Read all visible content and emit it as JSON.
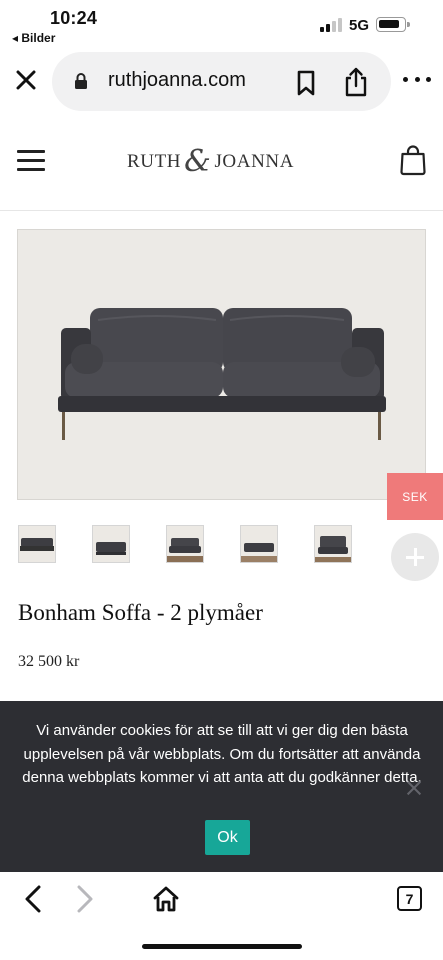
{
  "status_bar": {
    "time": "10:24",
    "back_app": "◂ Bilder",
    "network": "5G",
    "icons": [
      "signal-icon",
      "battery-icon"
    ]
  },
  "browser": {
    "url": "ruthjoanna.com",
    "icons": [
      "close-icon",
      "lock-icon",
      "bookmark-icon",
      "share-icon",
      "more-icon"
    ]
  },
  "site_header": {
    "logo": {
      "left": "RUTH",
      "amp": "&",
      "right": "JOANNA"
    },
    "icons": [
      "hamburger-menu-icon",
      "shopping-bag-icon"
    ]
  },
  "product": {
    "currency_badge": "SEK",
    "thumbnail_count": 5,
    "title": "Bonham Soffa - 2 plymåer",
    "price": "32 500 kr",
    "sofa_color": "#3d3d42",
    "image_background": "#eceae6"
  },
  "cookie_banner": {
    "text": "Vi använder cookies för att se till att vi ger dig den bästa upplevelsen på vår webbplats. Om du fortsätter att använda denna webbplats kommer vi att anta att du godkänner detta.",
    "ok_label": "Ok",
    "background": "#2d2e33",
    "ok_color": "#17a798"
  },
  "bottom_toolbar": {
    "tab_count": "7",
    "icons": [
      "back-arrow-icon",
      "forward-arrow-icon",
      "home-icon",
      "tabs-icon"
    ]
  },
  "colors": {
    "accent_badge": "#ef7a7a"
  }
}
